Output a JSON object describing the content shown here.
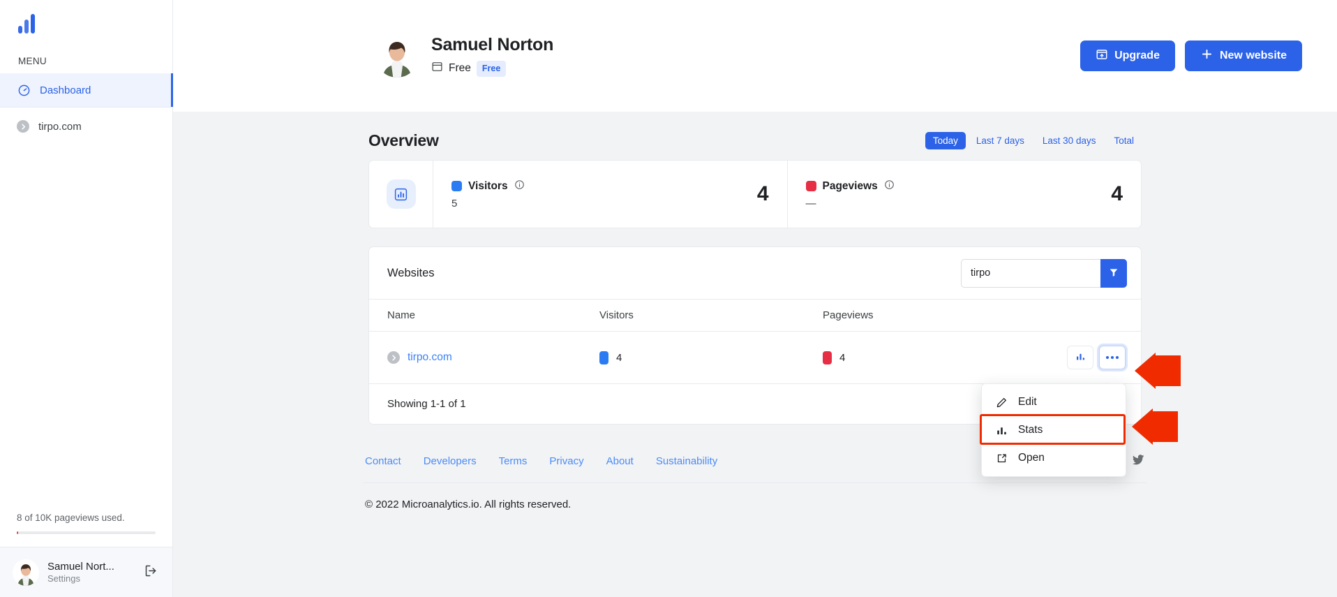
{
  "sidebar": {
    "logo_name": "microanalytics-logo",
    "menu_label": "MENU",
    "items": [
      {
        "label": "Dashboard",
        "icon": "gauge-icon",
        "active": true
      }
    ],
    "sites": [
      {
        "label": "tirpo.com",
        "icon": "circle-chevron-right-icon"
      }
    ],
    "quota_text": "8 of 10K pageviews used.",
    "quota_percent": 0.08,
    "user": {
      "name": "Samuel Nort...",
      "subtitle": "Settings",
      "logout_icon": "logout-icon"
    }
  },
  "header": {
    "user_name": "Samuel Norton",
    "plan_icon": "archive-box-icon",
    "plan_text": "Free",
    "plan_badge": "Free",
    "upgrade_button": "Upgrade",
    "upgrade_icon": "upload-box-icon",
    "new_website_button": "New website",
    "new_website_icon": "plus-icon"
  },
  "overview": {
    "title": "Overview",
    "ranges": [
      {
        "label": "Today",
        "active": true
      },
      {
        "label": "Last 7 days",
        "active": false
      },
      {
        "label": "Last 30 days",
        "active": false
      },
      {
        "label": "Total",
        "active": false
      }
    ],
    "card_icon": "bar-chart-icon",
    "metrics": [
      {
        "name": "Visitors",
        "color": "#2b7cf3",
        "previous": "5",
        "value": "4",
        "info_icon": "info-icon"
      },
      {
        "name": "Pageviews",
        "color": "#e62e45",
        "previous": "—",
        "value": "4",
        "info_icon": "info-icon"
      }
    ]
  },
  "websites": {
    "title": "Websites",
    "search_value": "tirpo",
    "search_placeholder": "",
    "filter_icon": "filter-icon",
    "columns": [
      "Name",
      "Visitors",
      "Pageviews"
    ],
    "rows": [
      {
        "name": "tirpo.com",
        "name_icon": "circle-chevron-right-icon",
        "visitors": "4",
        "visitors_color": "#2b7cf3",
        "pageviews": "4",
        "pageviews_color": "#e62e45",
        "stats_icon": "bar-chart-icon",
        "more_icon": "ellipsis-icon"
      }
    ],
    "showing": "Showing 1-1 of 1"
  },
  "dropdown": {
    "items": [
      {
        "label": "Edit",
        "icon": "pencil-icon",
        "highlighted": false
      },
      {
        "label": "Stats",
        "icon": "bar-chart-icon",
        "highlighted": true
      },
      {
        "label": "Open",
        "icon": "external-link-icon",
        "highlighted": false
      }
    ]
  },
  "footer": {
    "links": [
      "Contact",
      "Developers",
      "Terms",
      "Privacy",
      "About",
      "Sustainability"
    ],
    "socials": [
      {
        "name": "facebook-icon"
      },
      {
        "name": "twitter-icon"
      }
    ],
    "copyright": "© 2022 Microanalytics.io. All rights reserved."
  },
  "annotations": {
    "arrow_color": "#f02b00",
    "highlight_color": "#f02b00",
    "arrows": [
      "points-to-more-button",
      "points-to-stats-menu-item"
    ]
  },
  "colors": {
    "accent": "#2b62e8",
    "link": "#3b82f6",
    "visitors": "#2b7cf3",
    "pageviews": "#e62e45",
    "page_bg": "#f2f3f5",
    "panel_bg": "#ffffff",
    "border": "#e8eaed"
  }
}
